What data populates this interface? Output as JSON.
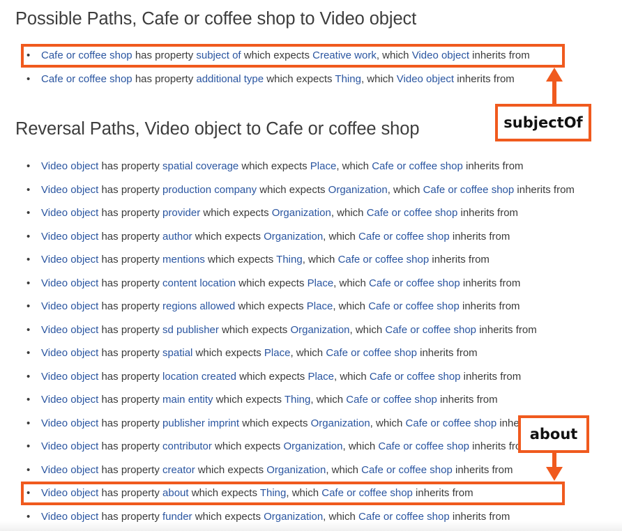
{
  "headings": {
    "possible": "Possible Paths, Cafe or coffee shop to Video object",
    "reversal": "Reversal Paths, Video object to Cafe or coffee shop"
  },
  "text": {
    "bullet": "•",
    "has_property": " has property ",
    "which_expects": " which expects ",
    "which": ", which ",
    "inherits_from": " inherits from"
  },
  "possible_paths": [
    {
      "subject": "Cafe or coffee shop",
      "property": "subject of",
      "expects": "Creative work",
      "which": "Video object"
    },
    {
      "subject": "Cafe or coffee shop",
      "property": "additional type",
      "expects": "Thing",
      "which": "Video object"
    }
  ],
  "reversal_paths": [
    {
      "subject": "Video object",
      "property": "spatial coverage",
      "expects": "Place",
      "which": "Cafe or coffee shop"
    },
    {
      "subject": "Video object",
      "property": "production company",
      "expects": "Organization",
      "which": "Cafe or coffee shop"
    },
    {
      "subject": "Video object",
      "property": "provider",
      "expects": "Organization",
      "which": "Cafe or coffee shop"
    },
    {
      "subject": "Video object",
      "property": "author",
      "expects": "Organization",
      "which": "Cafe or coffee shop"
    },
    {
      "subject": "Video object",
      "property": "mentions",
      "expects": "Thing",
      "which": "Cafe or coffee shop"
    },
    {
      "subject": "Video object",
      "property": "content location",
      "expects": "Place",
      "which": "Cafe or coffee shop"
    },
    {
      "subject": "Video object",
      "property": "regions allowed",
      "expects": "Place",
      "which": "Cafe or coffee shop"
    },
    {
      "subject": "Video object",
      "property": "sd publisher",
      "expects": "Organization",
      "which": "Cafe or coffee shop"
    },
    {
      "subject": "Video object",
      "property": "spatial",
      "expects": "Place",
      "which": "Cafe or coffee shop"
    },
    {
      "subject": "Video object",
      "property": "location created",
      "expects": "Place",
      "which": "Cafe or coffee shop"
    },
    {
      "subject": "Video object",
      "property": "main entity",
      "expects": "Thing",
      "which": "Cafe or coffee shop"
    },
    {
      "subject": "Video object",
      "property": "publisher imprint",
      "expects": "Organization",
      "which": "Cafe or coffee shop"
    },
    {
      "subject": "Video object",
      "property": "contributor",
      "expects": "Organization",
      "which": "Cafe or coffee shop"
    },
    {
      "subject": "Video object",
      "property": "creator",
      "expects": "Organization",
      "which": "Cafe or coffee shop"
    },
    {
      "subject": "Video object",
      "property": "about",
      "expects": "Thing",
      "which": "Cafe or coffee shop"
    },
    {
      "subject": "Video object",
      "property": "funder",
      "expects": "Organization",
      "which": "Cafe or coffee shop"
    }
  ],
  "annotations": {
    "subject_of_label": "subjectOf",
    "about_label": "about",
    "color": "#f05a1e"
  },
  "colors": {
    "link": "#2a55a0",
    "text": "#3a3a3a",
    "heading": "#3d3d3d"
  }
}
